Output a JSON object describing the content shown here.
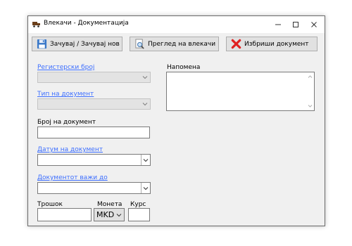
{
  "window": {
    "title": "Влекачи - Документација"
  },
  "toolbar": {
    "save_label": "Зачувај / Зачувај нов",
    "preview_label": "Преглед на влекачи",
    "delete_label": "Избриши документ"
  },
  "form": {
    "registration_label": "Регистерски број",
    "doc_type_label": "Тип на документ",
    "doc_number_label": "Број на документ",
    "doc_date_label": "Датум на документ",
    "valid_until_label": "Документот важи до",
    "cost_label": "Трошок",
    "currency_label": "Монета",
    "currency_value": "MKD",
    "rate_label": "Курс",
    "note_label": "Напомена"
  },
  "colors": {
    "link_label": "#3c6eff",
    "delete_x": "#e02020",
    "save_icon": "#3a78c8"
  }
}
